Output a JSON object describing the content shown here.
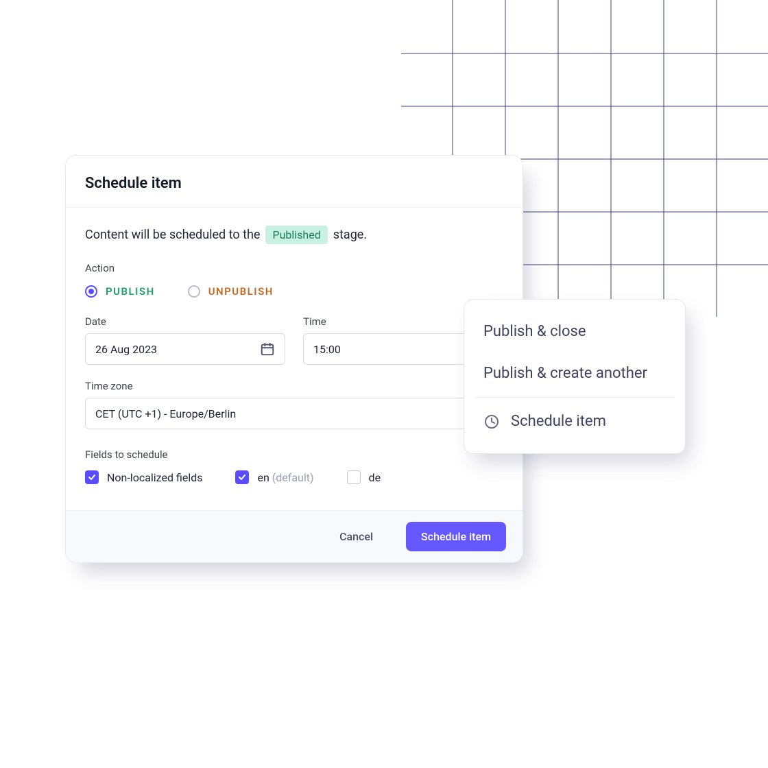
{
  "modal": {
    "title": "Schedule item",
    "sentence_pre": "Content will be scheduled to the",
    "stage_badge": "Published",
    "sentence_post": "stage.",
    "action_label": "Action",
    "actions": {
      "publish": "PUBLISH",
      "unpublish": "UNPUBLISH",
      "selected": "publish"
    },
    "date": {
      "label": "Date",
      "value": "26 Aug 2023"
    },
    "time": {
      "label": "Time",
      "value": "15:00"
    },
    "timezone": {
      "label": "Time zone",
      "value": "CET (UTC +1) - Europe/Berlin"
    },
    "fields_label": "Fields to schedule",
    "fields": {
      "nonlocalized": {
        "label": "Non-localized fields",
        "checked": true
      },
      "en": {
        "label": "en",
        "suffix": "(default)",
        "checked": true
      },
      "de": {
        "label": "de",
        "checked": false
      }
    },
    "footer": {
      "cancel": "Cancel",
      "submit": "Schedule item"
    }
  },
  "popover": {
    "items": [
      {
        "label": "Publish & close"
      },
      {
        "label": "Publish & create another"
      },
      {
        "label": "Schedule item",
        "icon": "clock"
      }
    ]
  }
}
